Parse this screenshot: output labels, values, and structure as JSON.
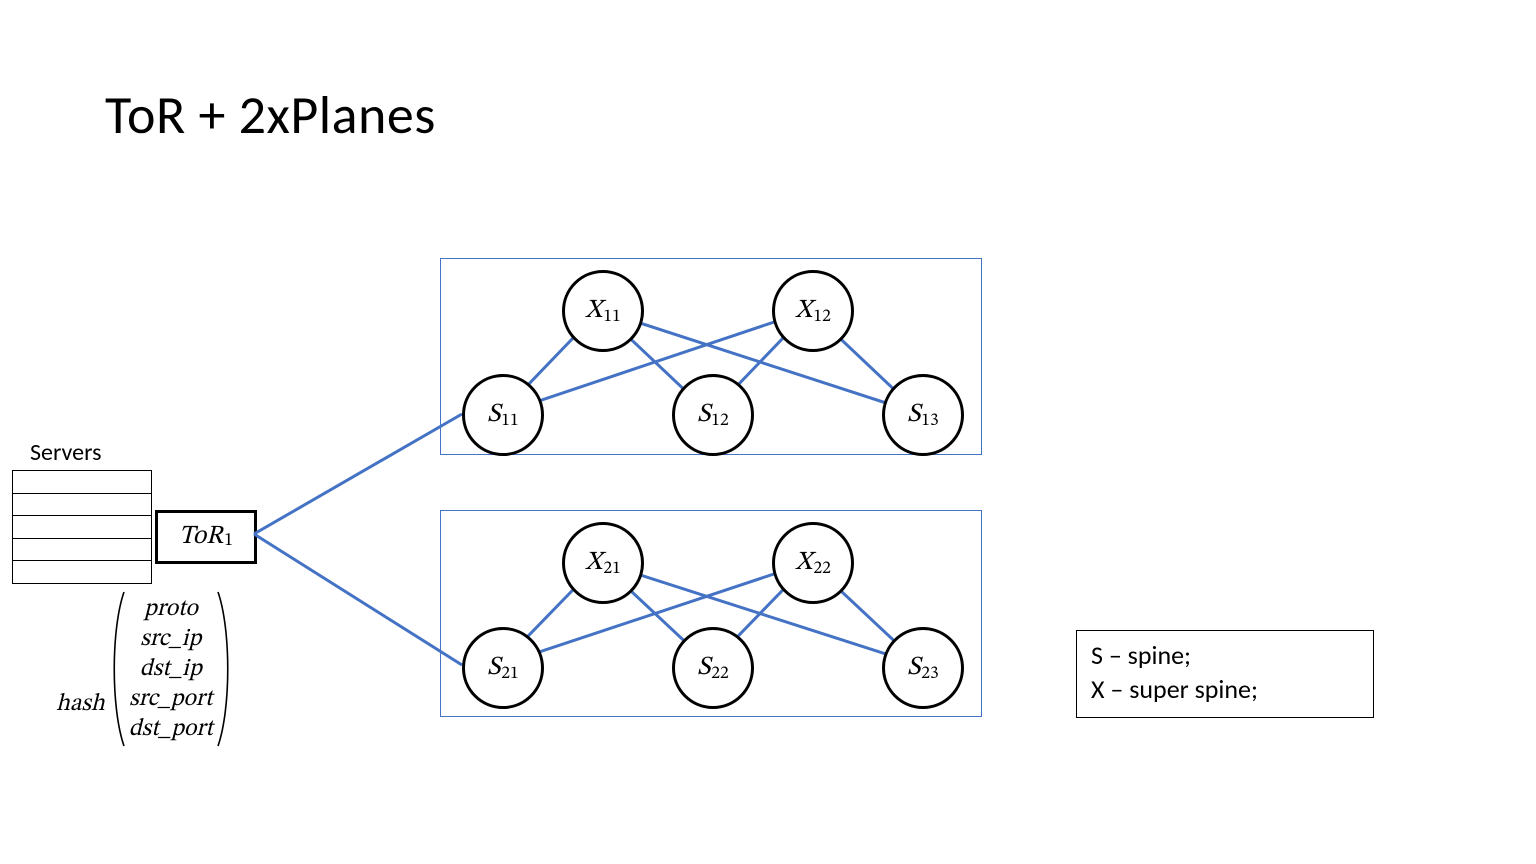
{
  "title": "ToR + 2xPlanes",
  "servers": {
    "label": "Servers",
    "count": 5
  },
  "tor": {
    "name": "ToR",
    "index": "1"
  },
  "hash": {
    "func": "hash",
    "tuple": [
      "proto",
      "src_ip",
      "dst_ip",
      "src_port",
      "dst_port"
    ]
  },
  "planes": {
    "plane1": {
      "super_spines": [
        {
          "name": "X",
          "index": "11"
        },
        {
          "name": "X",
          "index": "12"
        }
      ],
      "spines": [
        {
          "name": "S",
          "index": "11"
        },
        {
          "name": "S",
          "index": "12"
        },
        {
          "name": "S",
          "index": "13"
        }
      ]
    },
    "plane2": {
      "super_spines": [
        {
          "name": "X",
          "index": "21"
        },
        {
          "name": "X",
          "index": "22"
        }
      ],
      "spines": [
        {
          "name": "S",
          "index": "21"
        },
        {
          "name": "S",
          "index": "22"
        },
        {
          "name": "S",
          "index": "23"
        }
      ]
    }
  },
  "legend": {
    "line1": "S – spine;",
    "line2": "X – super spine;"
  },
  "topology_note": "Each spine S connects to every super-spine X within its plane (full bipartite). ToR connects to the first spine of each plane."
}
